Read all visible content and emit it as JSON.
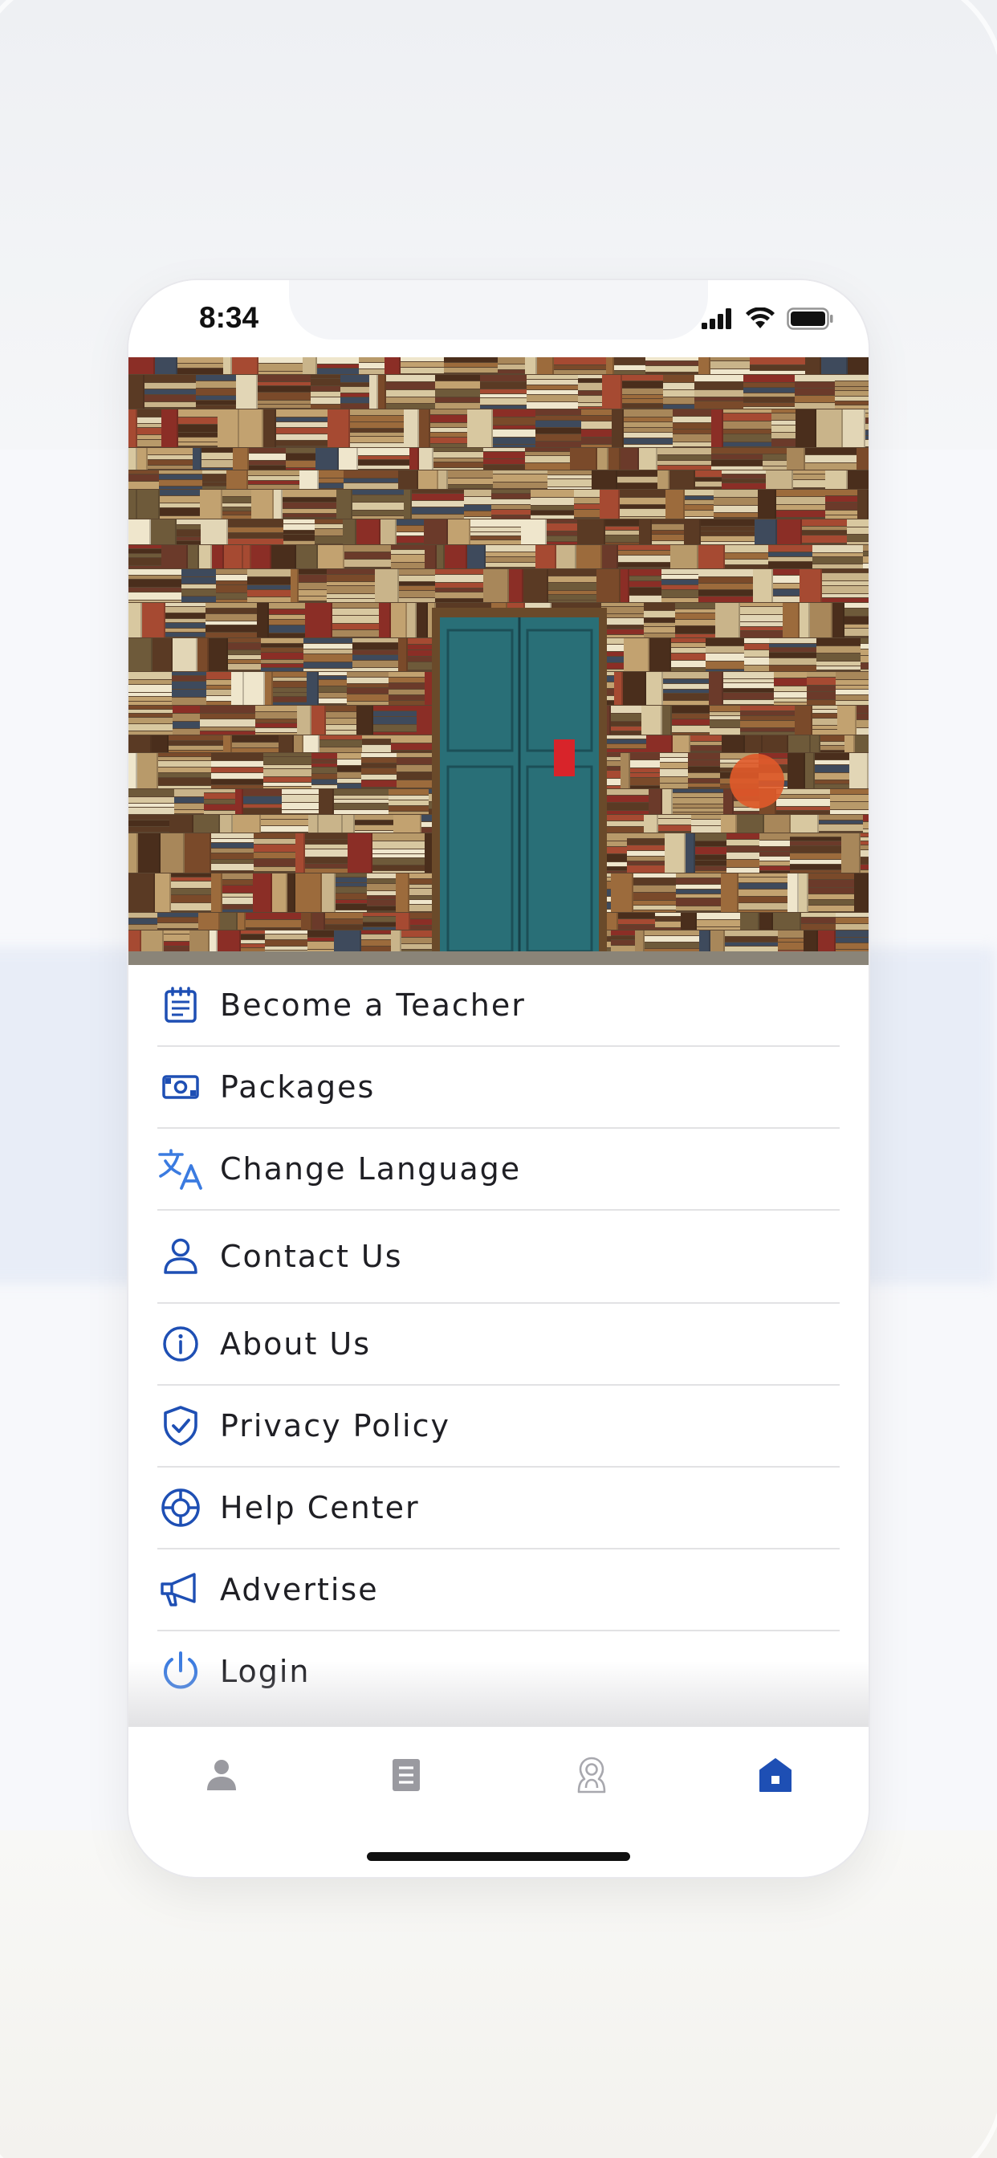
{
  "status_bar": {
    "time": "8:34"
  },
  "menu": {
    "items": [
      {
        "label": "Become a Teacher",
        "icon": "notepad-icon"
      },
      {
        "label": "Packages",
        "icon": "banknote-icon"
      },
      {
        "label": "Change Language",
        "icon": "translate-icon"
      },
      {
        "label": "Contact Us",
        "icon": "user-icon"
      },
      {
        "label": "About Us",
        "icon": "info-icon"
      },
      {
        "label": "Privacy Policy",
        "icon": "shield-check-icon"
      },
      {
        "label": "Help Center",
        "icon": "lifebuoy-icon"
      },
      {
        "label": "Advertise",
        "icon": "megaphone-icon"
      },
      {
        "label": "Login",
        "icon": "power-icon"
      }
    ]
  },
  "tabbar": {
    "tabs": [
      {
        "icon": "profile-icon",
        "active": false
      },
      {
        "icon": "document-icon",
        "active": false
      },
      {
        "icon": "teacher-icon",
        "active": false
      },
      {
        "icon": "home-icon",
        "active": true
      }
    ]
  },
  "colors": {
    "accent": "#1e4fb4",
    "accent_light": "#3b7be0",
    "inactive": "#9a9aa0",
    "text": "#1f1f24"
  }
}
